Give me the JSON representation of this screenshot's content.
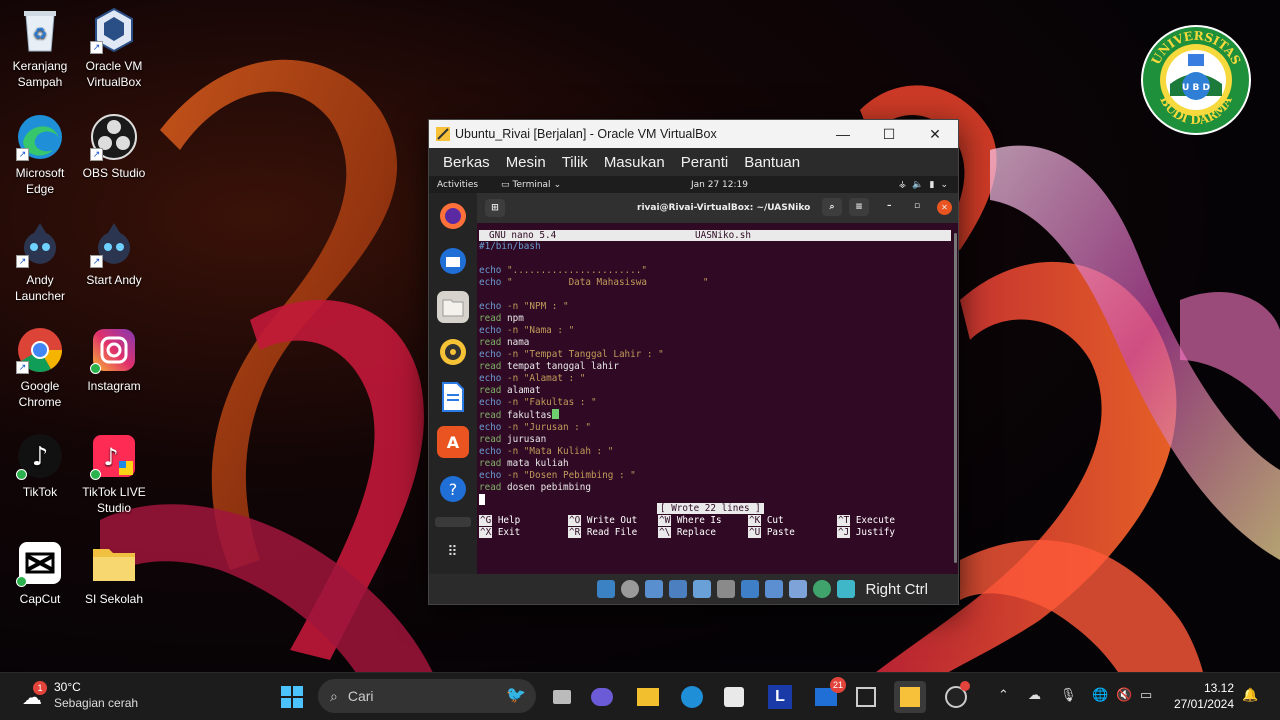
{
  "desktop": {
    "icons": [
      {
        "label": "Keranjang Sampah",
        "icon": "recycle-bin-icon"
      },
      {
        "label": "Oracle VM VirtualBox",
        "icon": "virtualbox-icon"
      },
      {
        "label": "Microsoft Edge",
        "icon": "edge-icon"
      },
      {
        "label": "OBS Studio",
        "icon": "obs-icon"
      },
      {
        "label": "Andy Launcher",
        "icon": "andy-icon"
      },
      {
        "label": "Start Andy",
        "icon": "andy-icon"
      },
      {
        "label": "Google Chrome",
        "icon": "chrome-icon"
      },
      {
        "label": "Instagram",
        "icon": "instagram-icon"
      },
      {
        "label": "TikTok",
        "icon": "tiktok-icon"
      },
      {
        "label": "TikTok LIVE Studio",
        "icon": "tiktok-live-icon"
      },
      {
        "label": "CapCut",
        "icon": "capcut-icon"
      },
      {
        "label": "SI Sekolah",
        "icon": "folder-icon"
      }
    ],
    "logo": {
      "top_text": "UNIVERSITAS",
      "bottom_text": "BUDI DARMA",
      "center_text": "U B D"
    }
  },
  "vbox": {
    "title": "Ubuntu_Rivai [Berjalan] - Oracle VM VirtualBox",
    "menu": [
      "Berkas",
      "Mesin",
      "Tilik",
      "Masukan",
      "Peranti",
      "Bantuan"
    ],
    "status_right": "Right Ctrl"
  },
  "guest": {
    "activities": "Activities",
    "app": "Terminal",
    "clock": "Jan 27  12:19",
    "terminal_title": "rivai@Rivai-VirtualBox: ~/UASNiko",
    "nano_version": "GNU nano 5.4",
    "file_name": "UASNiko.sh",
    "shebang": "#1/bin/bash",
    "lines": [
      {
        "cmd": "echo",
        "arg": "\".......................\"",
        "type": "echo"
      },
      {
        "cmd": "echo",
        "arg": "\"          Data Mahasiswa          \"",
        "type": "echo"
      },
      {
        "cmd": "echo",
        "arg": "-n \"NPM : \"",
        "type": "echo"
      },
      {
        "cmd": "read",
        "arg": "npm",
        "type": "read"
      },
      {
        "cmd": "echo",
        "arg": "-n \"Nama : \"",
        "type": "echo"
      },
      {
        "cmd": "read",
        "arg": "nama",
        "type": "read"
      },
      {
        "cmd": "echo",
        "arg": "-n \"Tempat Tanggal Lahir : \"",
        "type": "echo"
      },
      {
        "cmd": "read",
        "arg": "tempat tanggal lahir",
        "type": "read"
      },
      {
        "cmd": "echo",
        "arg": "-n \"Alamat : \"",
        "type": "echo"
      },
      {
        "cmd": "read",
        "arg": "alamat",
        "type": "read"
      },
      {
        "cmd": "echo",
        "arg": "-n \"Fakultas : \"",
        "type": "echo"
      },
      {
        "cmd": "read",
        "arg": "fakultas",
        "type": "read"
      },
      {
        "cmd": "echo",
        "arg": "-n \"Jurusan : \"",
        "type": "echo"
      },
      {
        "cmd": "read",
        "arg": "jurusan",
        "type": "read"
      },
      {
        "cmd": "echo",
        "arg": "-n \"Mata Kuliah : \"",
        "type": "echo"
      },
      {
        "cmd": "read",
        "arg": "mata kuliah",
        "type": "read"
      },
      {
        "cmd": "echo",
        "arg": "-n \"Dosen Pebimbing : \"",
        "type": "echo"
      },
      {
        "cmd": "read",
        "arg": "dosen pebimbing",
        "type": "read"
      }
    ],
    "status_message": "[ Wrote 22 lines ]",
    "shortcuts": [
      {
        "key": "^G",
        "label": "Help"
      },
      {
        "key": "^X",
        "label": "Exit"
      },
      {
        "key": "^O",
        "label": "Write Out"
      },
      {
        "key": "^R",
        "label": "Read File"
      },
      {
        "key": "^W",
        "label": "Where Is"
      },
      {
        "key": "^\\",
        "label": "Replace"
      },
      {
        "key": "^K",
        "label": "Cut"
      },
      {
        "key": "^U",
        "label": "Paste"
      },
      {
        "key": "^T",
        "label": "Execute"
      },
      {
        "key": "^J",
        "label": "Justify"
      }
    ]
  },
  "taskbar": {
    "weather_temp": "30°C",
    "weather_desc": "Sebagian cerah",
    "weather_badge": "1",
    "search_placeholder": "Cari",
    "mail_badge": "21",
    "time": "13.12",
    "date": "27/01/2024"
  }
}
